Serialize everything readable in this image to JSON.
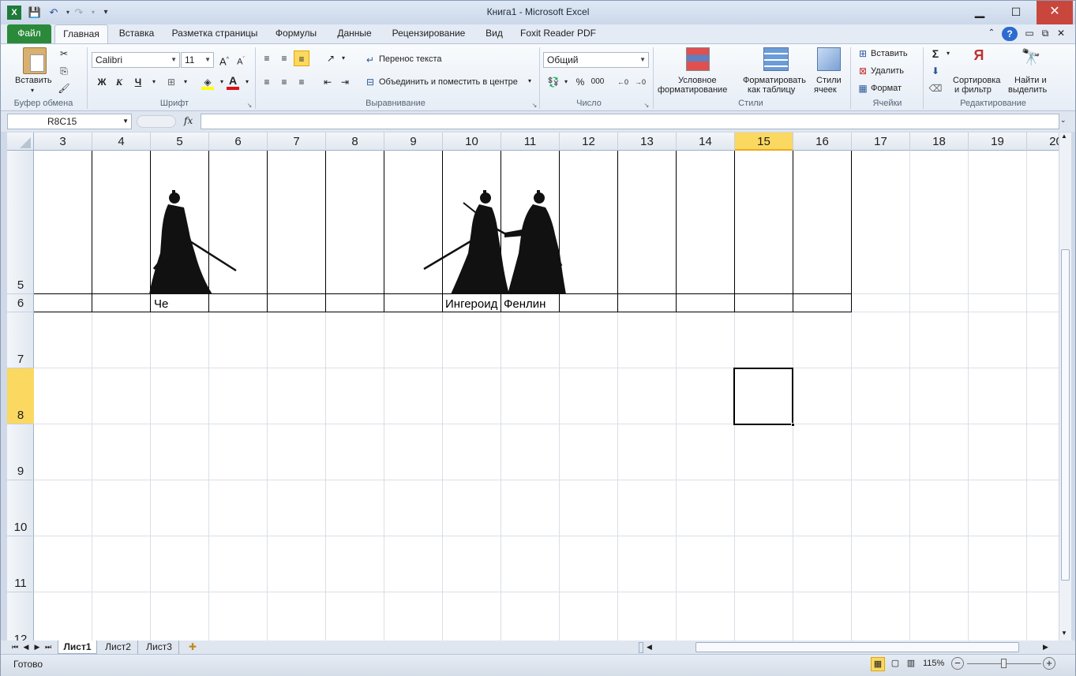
{
  "window": {
    "title": "Книга1  -  Microsoft Excel",
    "minimize": "▁",
    "maximize": "☐",
    "close": "✕"
  },
  "tabs": [
    "Файл",
    "Главная",
    "Вставка",
    "Разметка страницы",
    "Формулы",
    "Данные",
    "Рецензирование",
    "Вид",
    "Foxit Reader PDF"
  ],
  "ribbon": {
    "clipboard": {
      "paste": "Вставить",
      "label": "Буфер обмена"
    },
    "font": {
      "name": "Calibri",
      "size": "11",
      "bold": "Ж",
      "italic": "К",
      "underline": "Ч",
      "label": "Шрифт"
    },
    "alignment": {
      "wrap": "Перенос текста",
      "merge": "Объединить и поместить в центре",
      "label": "Выравнивание"
    },
    "number": {
      "format": "Общий",
      "percent": "%",
      "thousands": "000",
      "label": "Число"
    },
    "styles": {
      "conditional1": "Условное",
      "conditional2": "форматирование",
      "astable1": "Форматировать",
      "astable2": "как таблицу",
      "cellstyles1": "Стили",
      "cellstyles2": "ячеек",
      "label": "Стили"
    },
    "cells": {
      "insert": "Вставить",
      "delete": "Удалить",
      "format": "Формат",
      "label": "Ячейки"
    },
    "editing": {
      "sort1": "Сортировка",
      "sort2": "и фильтр",
      "find1": "Найти и",
      "find2": "выделить",
      "label": "Редактирование"
    }
  },
  "formula_bar": {
    "name_box": "R8C15",
    "fx": "fx",
    "formula": ""
  },
  "columns": [
    "3",
    "4",
    "5",
    "6",
    "7",
    "8",
    "9",
    "10",
    "11",
    "12",
    "13",
    "14",
    "15",
    "16",
    "17",
    "18",
    "19",
    "20"
  ],
  "selected_column": "15",
  "rows": [
    "5",
    "6",
    "7",
    "8",
    "9",
    "10",
    "11",
    "12"
  ],
  "selected_row": "8",
  "cells": {
    "r6c5": "Че",
    "r6c10": "Ингероид",
    "r6c11": "Фенлин"
  },
  "sheets": [
    "Лист1",
    "Лист2",
    "Лист3"
  ],
  "active_sheet": "Лист1",
  "status": {
    "ready": "Готово",
    "zoom": "115%"
  }
}
